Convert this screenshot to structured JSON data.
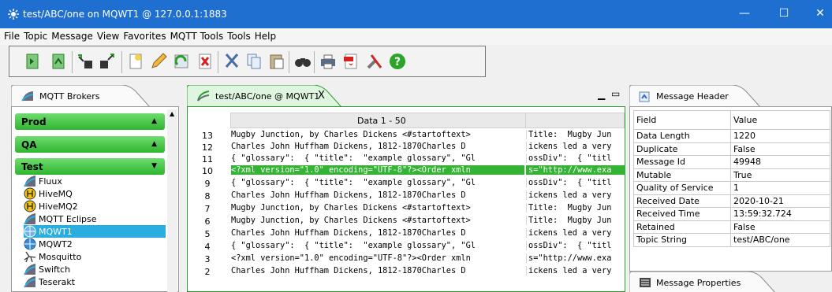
{
  "window": {
    "title": "test/ABC/one on MQWT1 @ 127.0.0.1:1883",
    "minimize": "—",
    "maximize": "☐",
    "close": "✕",
    "title_bar_color": "#1f6fd1"
  },
  "menu": [
    "File",
    "Topic",
    "Message",
    "View",
    "Favorites",
    "MQTT Tools",
    "Tools",
    "Help"
  ],
  "toolbar": {
    "icons": [
      "connect-icon",
      "disconnect-icon",
      "subscribe-icon",
      "unsubscribe-icon",
      "new-icon",
      "edit-icon",
      "refresh-icon",
      "delete-icon",
      "cut-icon",
      "copy-icon",
      "paste-icon",
      "find-icon",
      "print-icon",
      "pdf-icon",
      "tools-icon",
      "help-icon"
    ]
  },
  "brokers_panel": {
    "tab_label": "MQTT Brokers",
    "groups": [
      {
        "label": "Prod",
        "arrow": "▲"
      },
      {
        "label": "QA",
        "arrow": "▲"
      },
      {
        "label": "Test",
        "arrow": "▼"
      }
    ],
    "brokers": [
      "Fluux",
      "HiveMQ",
      "HiveMQ2",
      "MQTT Eclipse",
      "MQWT1",
      "MQWT2",
      "Mosquitto",
      "Swiftch",
      "Teserakt"
    ],
    "selected": "MQWT1",
    "accent": "#2fb52f"
  },
  "data_panel": {
    "tab_label": "test/ABC/one @ MQWT1",
    "tab_close": "X",
    "column_header": "Data 1 - 50",
    "rows": [
      {
        "n": "13",
        "c1": "Mugby Junction, by Charles Dickens <#startoftext>",
        "c2": "Title:  Mugby Jun"
      },
      {
        "n": "12",
        "c1": "Charles John Huffham Dickens, 1812-1870Charles D",
        "c2": "ickens led a very"
      },
      {
        "n": "11",
        "c1": "{ \"glossary\":  { \"title\":  \"example glossary\", \"Gl",
        "c2": "ossDiv\":  { \"titl"
      },
      {
        "n": "10",
        "c1": "<?xml version=\"1.0\" encoding=\"UTF-8\"?><Order xmln",
        "c2": "s=\"http://www.exa"
      },
      {
        "n": "9",
        "c1": "{ \"glossary\":  { \"title\":  \"example glossary\", \"Gl",
        "c2": "ossDiv\":  { \"titl"
      },
      {
        "n": "8",
        "c1": "Charles John Huffham Dickens, 1812-1870Charles D",
        "c2": "ickens led a very"
      },
      {
        "n": "7",
        "c1": "Mugby Junction, by Charles Dickens <#startoftext>",
        "c2": "Title:  Mugby Jun"
      },
      {
        "n": "6",
        "c1": "Mugby Junction, by Charles Dickens <#startoftext>",
        "c2": "Title:  Mugby Jun"
      },
      {
        "n": "5",
        "c1": "Charles John Huffham Dickens, 1812-1870Charles D",
        "c2": "ickens led a very"
      },
      {
        "n": "4",
        "c1": "{ \"glossary\":  { \"title\":  \"example glossary\", \"Gl",
        "c2": "ossDiv\":  { \"titl"
      },
      {
        "n": "3",
        "c1": "<?xml version=\"1.0\" encoding=\"UTF-8\"?><Order xmln",
        "c2": "s=\"http://www.exa"
      },
      {
        "n": "2",
        "c1": "Charles John Huffham Dickens, 1812-1870Charles D",
        "c2": "ickens led a very"
      }
    ],
    "highlight_row": "10",
    "highlight_color": "#35b335"
  },
  "header_panel": {
    "tab_label": "Message Header",
    "columns": [
      "Field",
      "Value"
    ],
    "rows": [
      {
        "field": "Data Length",
        "value": "1220"
      },
      {
        "field": "Duplicate",
        "value": "False"
      },
      {
        "field": "Message Id",
        "value": "49948"
      },
      {
        "field": "Mutable",
        "value": "True"
      },
      {
        "field": "Quality of Service",
        "value": "1"
      },
      {
        "field": "Received Date",
        "value": "2020-10-21"
      },
      {
        "field": "Received Time",
        "value": "13:59:32.724"
      },
      {
        "field": "Retained",
        "value": "False"
      },
      {
        "field": "Topic String",
        "value": "test/ABC/one"
      }
    ]
  },
  "properties_panel": {
    "tab_label": "Message Properties"
  }
}
